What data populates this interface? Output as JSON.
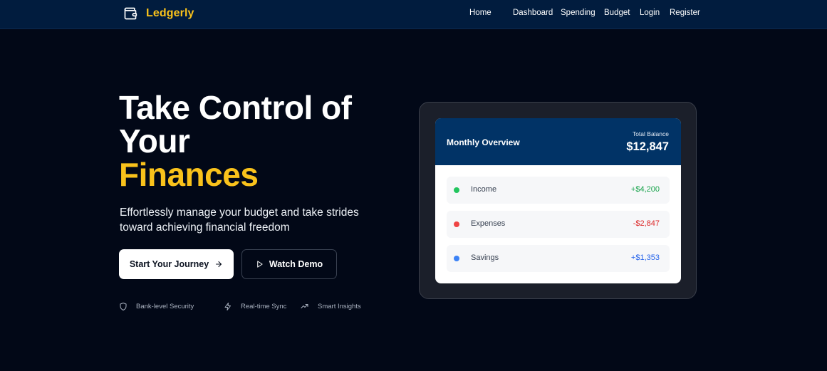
{
  "brand": {
    "name": "Ledgerly",
    "icon": "wallet-icon",
    "color": "#f9c21b"
  },
  "nav": {
    "links": [
      {
        "label": "Home"
      },
      {
        "label": "Dashboard"
      },
      {
        "label": "Spending"
      },
      {
        "label": "Budget"
      },
      {
        "label": "Login"
      },
      {
        "label": "Register"
      }
    ]
  },
  "hero": {
    "title_line1": "Take Control of",
    "title_line2": "Your",
    "title_accent": "Finances",
    "subtitle": "Effortlessly manage your budget and take strides toward achieving financial freedom",
    "primary_button": "Start Your Journey",
    "secondary_button": "Watch Demo",
    "features": [
      {
        "label": "Bank-level Security",
        "icon": "shield-icon"
      },
      {
        "label": "Real-time Sync",
        "icon": "lightning-icon"
      },
      {
        "label": "Smart Insights",
        "icon": "trending-up-icon"
      }
    ]
  },
  "overview": {
    "title": "Monthly Overview",
    "balance_label": "Total Balance",
    "balance_value": "$12,847",
    "rows": [
      {
        "label": "Income",
        "value": "+$4,200",
        "color": "#22c55e"
      },
      {
        "label": "Expenses",
        "value": "-$2,847",
        "color": "#ef4444"
      },
      {
        "label": "Savings",
        "value": "+$1,353",
        "color": "#3b82f6"
      }
    ]
  }
}
